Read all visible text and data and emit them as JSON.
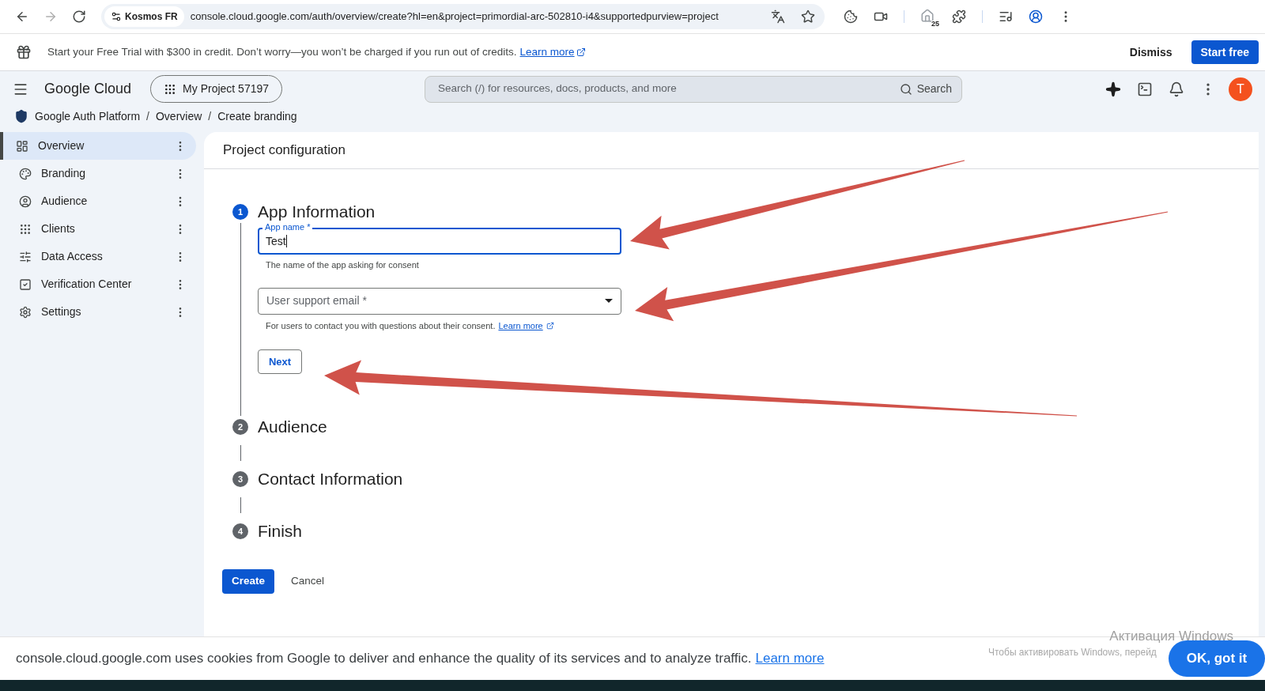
{
  "browser": {
    "site_chip": "Kosmos FR",
    "url": "console.cloud.google.com/auth/overview/create?hl=en&project=primordial-arc-502810-i4&supportedpurview=project",
    "badge": "25"
  },
  "trial_banner": {
    "text": "Start your Free Trial with $300 in credit. Don’t worry—you won’t be charged if you run out of credits.",
    "link": "Learn more",
    "dismiss": "Dismiss",
    "start": "Start free"
  },
  "header": {
    "brand": "Google Cloud",
    "project": "My Project 57197",
    "search_placeholder": "Search (/) for resources, docs, products, and more",
    "search_button": "Search",
    "avatar": "T"
  },
  "breadcrumb": {
    "items": [
      "Google Auth Platform",
      "Overview",
      "Create branding"
    ],
    "separators": [
      "/",
      "/"
    ]
  },
  "sidebar": {
    "items": [
      {
        "label": "Overview",
        "kind": "dashboard",
        "selected": true
      },
      {
        "label": "Branding",
        "kind": "palette",
        "selected": false
      },
      {
        "label": "Audience",
        "kind": "person",
        "selected": false
      },
      {
        "label": "Clients",
        "kind": "grid",
        "selected": false
      },
      {
        "label": "Data Access",
        "kind": "data",
        "selected": false
      },
      {
        "label": "Verification Center",
        "kind": "check",
        "selected": false
      },
      {
        "label": "Settings",
        "kind": "gear",
        "selected": false
      }
    ]
  },
  "main": {
    "title": "Project configuration",
    "steps": [
      {
        "number": "1",
        "label": "App Information",
        "active": true
      },
      {
        "number": "2",
        "label": "Audience",
        "active": false
      },
      {
        "number": "3",
        "label": "Contact Information",
        "active": false
      },
      {
        "number": "4",
        "label": "Finish",
        "active": false
      }
    ],
    "app_name": {
      "label": "App name *",
      "value": "Test",
      "hint": "The name of the app asking for consent"
    },
    "support_email": {
      "placeholder": "User support email *",
      "hint": "For users to contact you with questions about their consent.",
      "link": "Learn more"
    },
    "next": "Next",
    "create": "Create",
    "cancel": "Cancel"
  },
  "cookie_bar": {
    "text": "console.cloud.google.com uses cookies from Google to deliver and enhance the quality of its services and to analyze traffic.",
    "link": "Learn more",
    "ok": "OK, got it"
  },
  "windows_notice": {
    "title": "Активация Windows",
    "text": "Чтобы активировать Windows, перейд"
  }
}
